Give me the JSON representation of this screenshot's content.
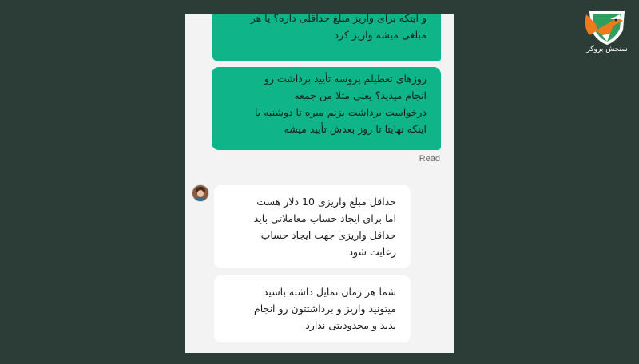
{
  "chat": {
    "messages": [
      {
        "direction": "outgoing",
        "text": "و اینکه برای واریز مبلغ حداقلی داره؟ یا هر\nمبلغی میشه واریز کرد"
      },
      {
        "direction": "outgoing",
        "text": "روزهای تعطیلم پروسه تأیید برداشت رو\nانجام میدید؟ یعنی مثلا من جمعه\nدرخواست برداشت بزنم میره تا دوشنبه یا\nاینکه نهایتا تا روز بعدش تأیید میشه"
      },
      {
        "direction": "incoming",
        "text": "حداقل مبلغ واریزی 10 دلار هست\nاما برای ایجاد حساب معاملاتی باید\nحداقل واریزی جهت ایجاد حساب\nرعایت شود"
      },
      {
        "direction": "incoming",
        "text": "شما هر زمان تمایل داشته باشید\nمیتونید واریز و برداشتتون رو انجام\nبدید و محدودیتی ندارد"
      }
    ],
    "read_receipt": "Read"
  },
  "brand": {
    "caption": "سنجش بروکر",
    "icon": "fox-shield-logo",
    "colors": {
      "orange": "#f07a1a",
      "green": "#2f9e5e",
      "background": "#2c3c37",
      "bubble_out": "#0fb489"
    }
  }
}
